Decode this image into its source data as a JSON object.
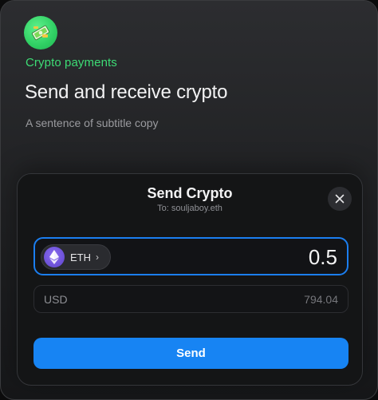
{
  "header": {
    "icon": "money-icon",
    "eyebrow": "Crypto payments",
    "title": "Send and receive crypto",
    "subtitle": "A sentence of subtitle copy"
  },
  "modal": {
    "title": "Send Crypto",
    "recipient": "To: souljaboy.eth",
    "close_icon": "close-icon",
    "token": {
      "icon": "ethereum-icon",
      "symbol": "ETH",
      "chevron": "›"
    },
    "amount": "0.5",
    "fiat": {
      "label": "USD",
      "value": "794.04"
    },
    "send_label": "Send"
  },
  "colors": {
    "accent_green": "#3ddc75",
    "accent_blue": "#1784f3",
    "focus_border": "#1b7ef0",
    "eth_purple": "#6a4fd6"
  }
}
